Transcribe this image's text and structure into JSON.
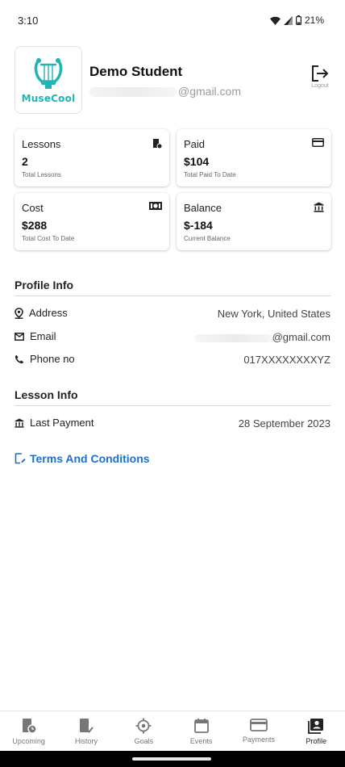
{
  "status_bar": {
    "time": "3:10",
    "battery": "21%"
  },
  "profile": {
    "logo_text": "MuseCool",
    "name": "Demo Student",
    "email_visible": "@gmail.com",
    "logout_label": "Logout"
  },
  "cards": [
    {
      "title": "Lessons",
      "value": "2",
      "subtitle": "Total Lessons",
      "icon": "lessons-book-icon"
    },
    {
      "title": "Paid",
      "value": "$104",
      "subtitle": "Total Paid To Date",
      "icon": "credit-card-icon"
    },
    {
      "title": "Cost",
      "value": "$288",
      "subtitle": "Total Cost To Date",
      "icon": "cash-icon"
    },
    {
      "title": "Balance",
      "value": "$-184",
      "subtitle": "Current Balance",
      "icon": "bank-icon"
    }
  ],
  "profile_info": {
    "title": "Profile Info",
    "rows": [
      {
        "label": "Address",
        "value": "New York, United States",
        "icon": "location-pin-icon"
      },
      {
        "label": "Email",
        "value": "@gmail.com",
        "icon": "mail-icon"
      },
      {
        "label": "Phone no",
        "value": "017XXXXXXXXYZ",
        "icon": "phone-icon"
      }
    ]
  },
  "lesson_info": {
    "title": "Lesson Info",
    "rows": [
      {
        "label": "Last Payment",
        "value": "28 September 2023",
        "icon": "bank-icon"
      }
    ]
  },
  "terms": {
    "label": "Terms And Conditions",
    "icon": "edit-document-icon"
  },
  "nav": [
    {
      "label": "Upcoming",
      "icon": "upcoming-book-clock-icon",
      "active": false
    },
    {
      "label": "History",
      "icon": "history-book-check-icon",
      "active": false
    },
    {
      "label": "Goals",
      "icon": "target-icon",
      "active": false
    },
    {
      "label": "Events",
      "icon": "calendar-icon",
      "active": false
    },
    {
      "label": "Payments",
      "icon": "credit-card-icon",
      "active": false
    },
    {
      "label": "Profile",
      "icon": "profile-contacts-icon",
      "active": true
    }
  ],
  "colors": {
    "accent_link": "#1a6fd6",
    "logo_teal": "#1fb5b5",
    "nav_icon": "#777777"
  }
}
